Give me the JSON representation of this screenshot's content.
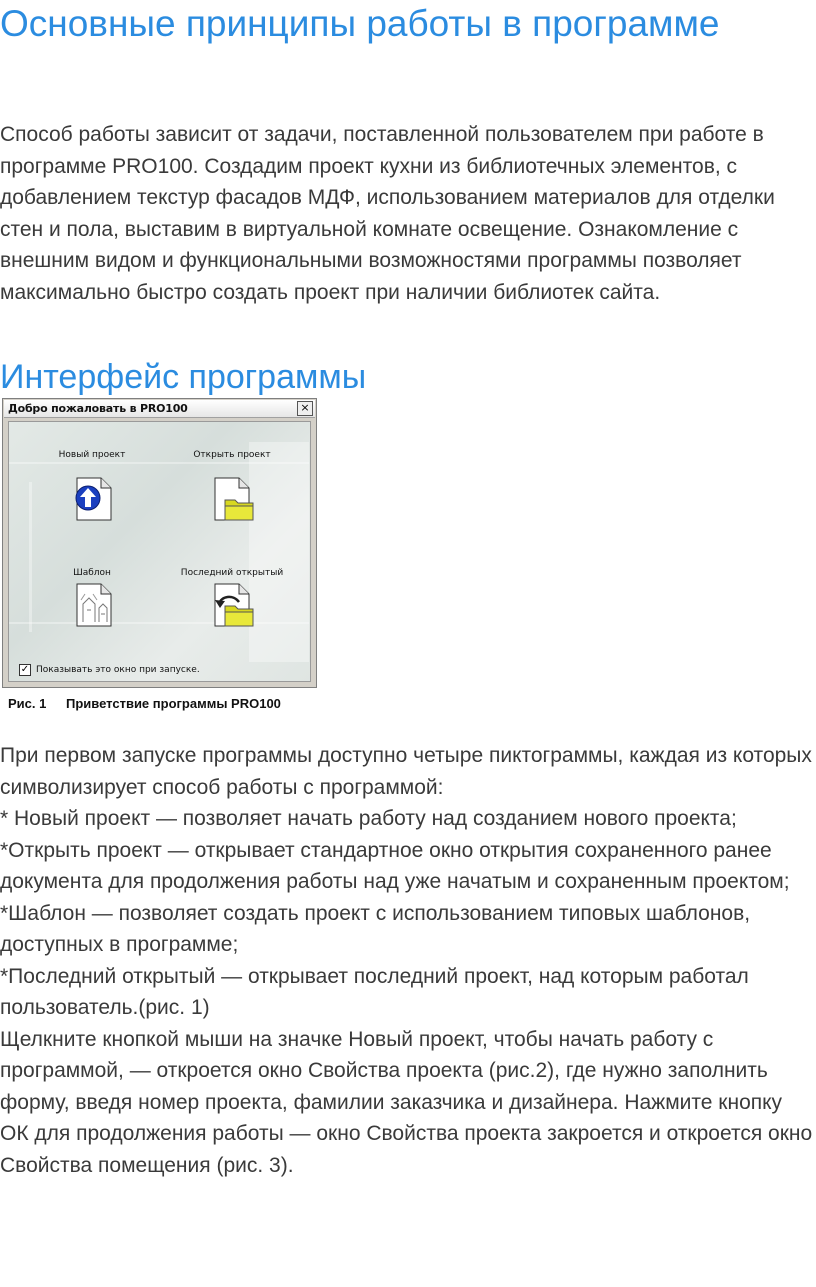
{
  "title": "Основные принципы работы в программе",
  "intro": "Способ работы зависит от задачи, поставленной пользователем при работе в программе PRO100. Создадим проект кухни из библиотечных элементов, с добавлением текстур фасадов МДФ, использованием материалов для отделки стен и пола, выставим в виртуальной комнате освещение.  Ознакомление с внешним видом и функциональными возможностями программы позволяет максимально быстро создать проект при наличии библиотек сайта.",
  "section_title": "Интерфейс программы",
  "dialog": {
    "title": "Добро пожаловать в PRO100",
    "close": "×",
    "tiles": [
      {
        "label": "Новый проект",
        "icon": "new-project-icon"
      },
      {
        "label": "Открыть проект",
        "icon": "open-project-icon"
      },
      {
        "label": "Шаблон",
        "icon": "template-icon"
      },
      {
        "label": "Последний открытый",
        "icon": "last-opened-icon"
      }
    ],
    "checkbox_mark": "✓",
    "checkbox_label": "Показывать это окно при запуске."
  },
  "caption": {
    "number": "Рис. 1",
    "text": "Приветствие программы PRO100"
  },
  "body_lines": [
    "При первом запуске программы доступно четыре пиктограммы, каждая из которых символизирует способ работы с программой:",
    "* Новый проект — позволяет начать работу над созданием нового проекта;",
    "*Открыть проект — открывает стандартное окно открытия сохраненного ранее документа для продолжения работы над уже начатым и сохраненным проектом;",
    "*Шаблон — позволяет создать проект с использованием типовых шаблонов, доступных в программе;",
    "*Последний открытый — открывает последний проект, над которым работал пользователь.(рис. 1)",
    "Щелкните кнопкой мыши на значке Новый проект, чтобы начать работу с программой, — откроется окно Свойства проекта (рис.2), где нужно заполнить форму, введя номер проекта, фамилии заказчика и дизайнера. Нажмите кнопку ОК для продолжения работы — окно Свойства проекта закроется и откроется окно Свойства помещения (рис. 3)."
  ]
}
